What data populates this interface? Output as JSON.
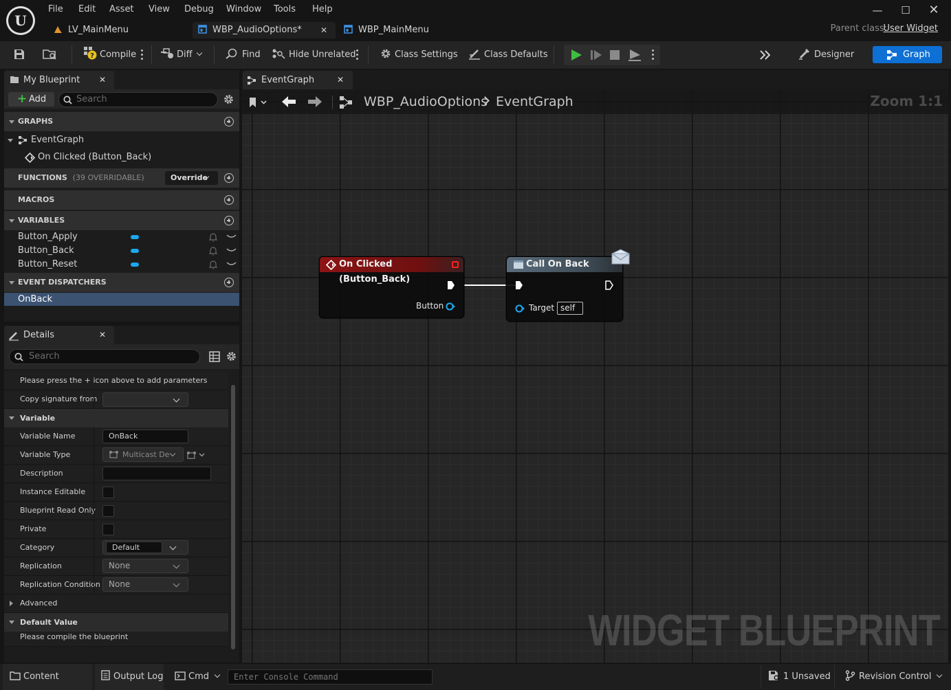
{
  "menu": [
    "File",
    "Edit",
    "Asset",
    "View",
    "Debug",
    "Window",
    "Tools",
    "Help"
  ],
  "doc_tabs": [
    {
      "label": "LV_MainMenu"
    },
    {
      "label": "WBP_AudioOptions*"
    },
    {
      "label": "WBP_MainMenu"
    }
  ],
  "parent_class": {
    "label": "Parent class:",
    "value": "User Widget"
  },
  "toolbar": {
    "compile": "Compile",
    "diff": "Diff",
    "find": "Find",
    "hide_unrelated": "Hide Unrelated",
    "class_settings": "Class Settings",
    "class_defaults": "Class Defaults",
    "designer": "Designer",
    "graph": "Graph"
  },
  "my_blueprint": {
    "tab": "My Blueprint",
    "add": "Add",
    "search_placeholder": "Search",
    "graphs_header": "GRAPHS",
    "graph_items": [
      {
        "label": "EventGraph"
      },
      {
        "label": "On Clicked (Button_Back)"
      }
    ],
    "functions_header": "FUNCTIONS",
    "functions_count": "(39 OVERRIDABLE)",
    "override": "Override",
    "macros_header": "MACROS",
    "variables_header": "VARIABLES",
    "variables": [
      {
        "name": "Button_Apply",
        "color": "#1aa9ee"
      },
      {
        "name": "Button_Back",
        "color": "#1aa9ee"
      },
      {
        "name": "Button_Reset",
        "color": "#1aa9ee"
      }
    ],
    "dispatchers_header": "EVENT DISPATCHERS",
    "dispatchers": [
      {
        "name": "OnBack"
      }
    ]
  },
  "details": {
    "tab": "Details",
    "search_placeholder": "Search",
    "hint": "Please press the + icon above to add parameters",
    "copy_signature": "Copy signature from",
    "variable_section": "Variable",
    "rows": {
      "variable_name": {
        "label": "Variable Name",
        "value": "OnBack"
      },
      "variable_type": {
        "label": "Variable Type",
        "value": "Multicast De"
      },
      "description": {
        "label": "Description",
        "value": ""
      },
      "instance_editable": {
        "label": "Instance Editable"
      },
      "blueprint_read_only": {
        "label": "Blueprint Read Only"
      },
      "private": {
        "label": "Private"
      },
      "category": {
        "label": "Category",
        "value": "Default"
      },
      "replication": {
        "label": "Replication",
        "value": "None"
      },
      "replication_condition": {
        "label": "Replication Condition",
        "value": "None"
      }
    },
    "advanced": "Advanced",
    "default_value_section": "Default Value",
    "default_value_hint": "Please compile the blueprint"
  },
  "graph": {
    "tab": "EventGraph",
    "breadcrumb": [
      "WBP_AudioOptions",
      "EventGraph"
    ],
    "zoom": "Zoom 1:1",
    "watermark": "WIDGET BLUEPRINT",
    "event_node": {
      "title": "On Clicked (Button_Back)",
      "output_pin": "Button",
      "header_color": "#8c1414"
    },
    "call_node": {
      "title": "Call On Back",
      "target_label": "Target",
      "target_value": "self",
      "header_color": "#4e5e6c"
    }
  },
  "statusbar": {
    "content_drawer": "Content Drawer",
    "output_log": "Output Log",
    "cmd": "Cmd",
    "console_placeholder": "Enter Console Command",
    "unsaved": "1 Unsaved",
    "revision_control": "Revision Control"
  },
  "colors": {
    "accent": "#0e70d4",
    "pin_blue": "#1aa9ee",
    "selected_row": "#3b5271",
    "event_header": "#8c1414"
  }
}
